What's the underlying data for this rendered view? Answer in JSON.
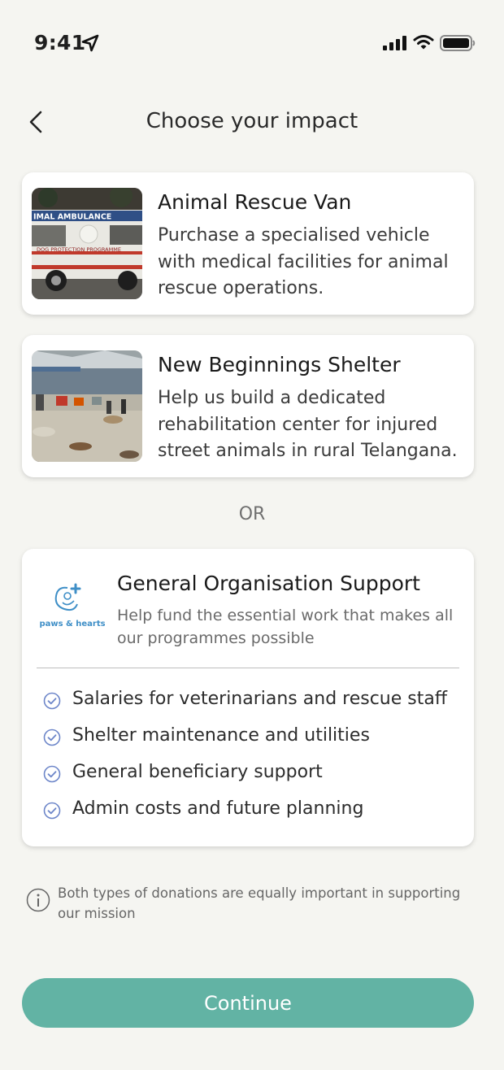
{
  "status_bar": {
    "time": "9:41",
    "icons": [
      "location-arrow-icon",
      "cellular-signal-icon",
      "wifi-icon",
      "battery-icon"
    ]
  },
  "header": {
    "back_icon": "chevron-left-icon",
    "title": "Choose your impact"
  },
  "projects": [
    {
      "title": "Animal Rescue Van",
      "description": "Purchase a specialised vehicle with medical facilities for animal rescue operations.",
      "image": {
        "van_lettering": "IMAL AMBULANCE",
        "van_sign": "DOG PROTECTION PROGRAMME"
      }
    },
    {
      "title": "New Beginnings Shelter",
      "description": "Help us build a dedicated rehabilitation center for injured street animals in rural Telangana.",
      "image": {}
    }
  ],
  "separator": "OR",
  "general_support": {
    "logo_text": "paws & hearts",
    "title": "General Organisation Support",
    "description": "Help fund the essential work that makes all our programmes possible",
    "check_icon": "check-circle-icon",
    "benefits": [
      "Salaries for veterinarians and rescue staff",
      "Shelter maintenance and utilities",
      "General beneficiary support",
      "Admin costs and future planning"
    ]
  },
  "note": {
    "icon": "info-icon",
    "text": "Both types of donations are equally important in supporting our mission"
  },
  "continue_button": {
    "label": "Continue",
    "color": "#62b3a4"
  },
  "colors": {
    "background": "#f5f5f1",
    "card": "#ffffff",
    "accent_check": "#6d86c9"
  }
}
